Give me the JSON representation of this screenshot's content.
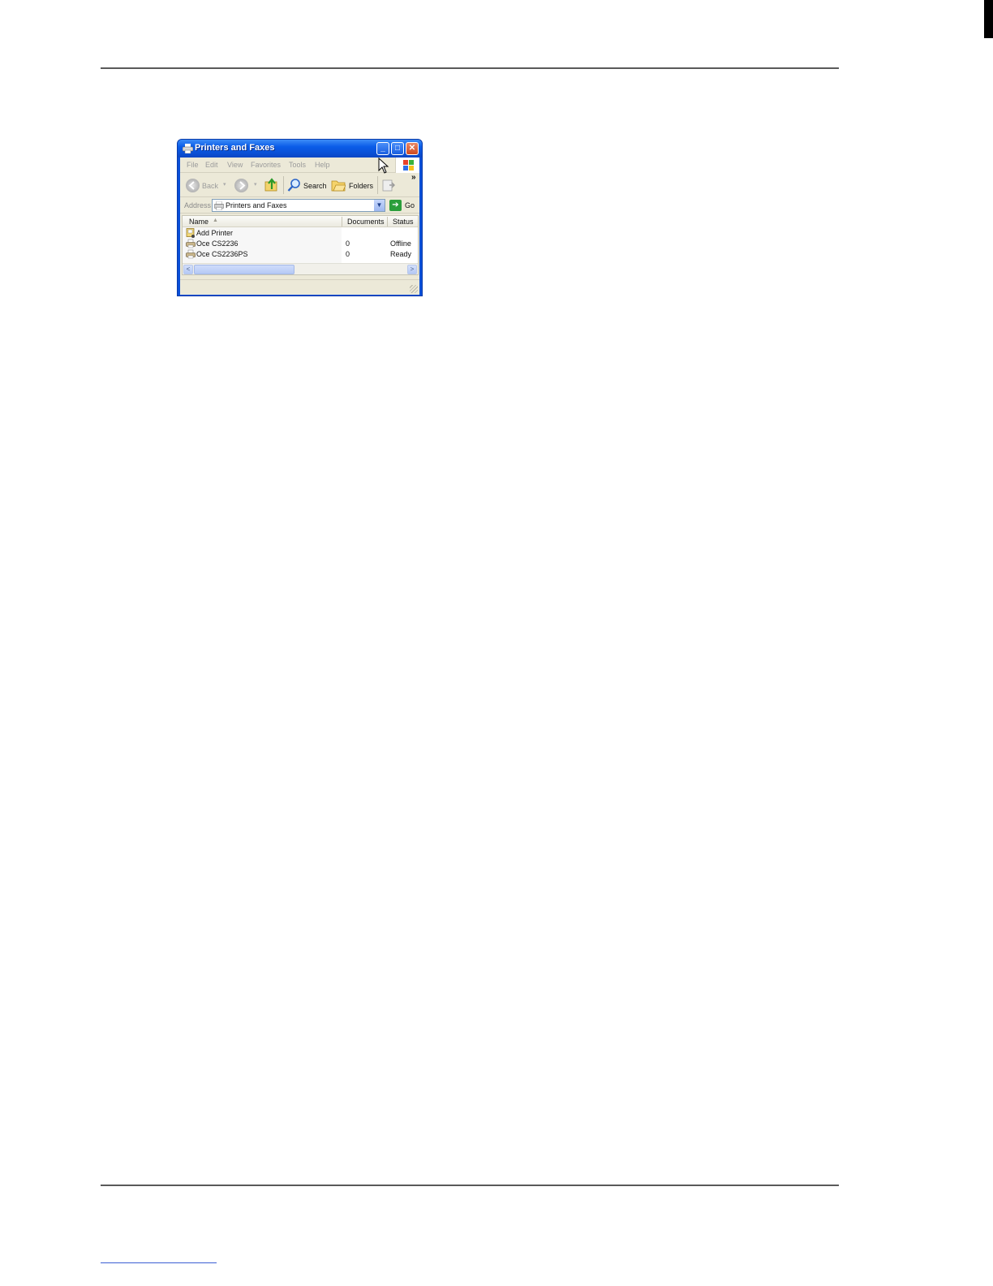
{
  "window": {
    "title": "Printers and Faxes",
    "controls": {
      "minimize": "_",
      "maximize": "□",
      "close": "✕"
    }
  },
  "menu": [
    "File",
    "Edit",
    "View",
    "Favorites",
    "Tools",
    "Help"
  ],
  "toolbar": {
    "back_label": "Back",
    "search_label": "Search",
    "folders_label": "Folders",
    "overflow": "»"
  },
  "address": {
    "label": "Address",
    "value": "Printers and Faxes",
    "go_label": "Go"
  },
  "list": {
    "columns": {
      "name": "Name",
      "documents": "Documents",
      "status": "Status"
    },
    "rows": [
      {
        "name": "Add Printer",
        "documents": "",
        "status": ""
      },
      {
        "name": "Oce CS2236",
        "documents": "0",
        "status": "Offline"
      },
      {
        "name": "Oce CS2236PS",
        "documents": "0",
        "status": "Ready"
      }
    ]
  },
  "colors": {
    "titlebar": "#0a5ce8",
    "chrome": "#ece9d8",
    "close": "#d0491f",
    "go": "#2b9e3b"
  }
}
